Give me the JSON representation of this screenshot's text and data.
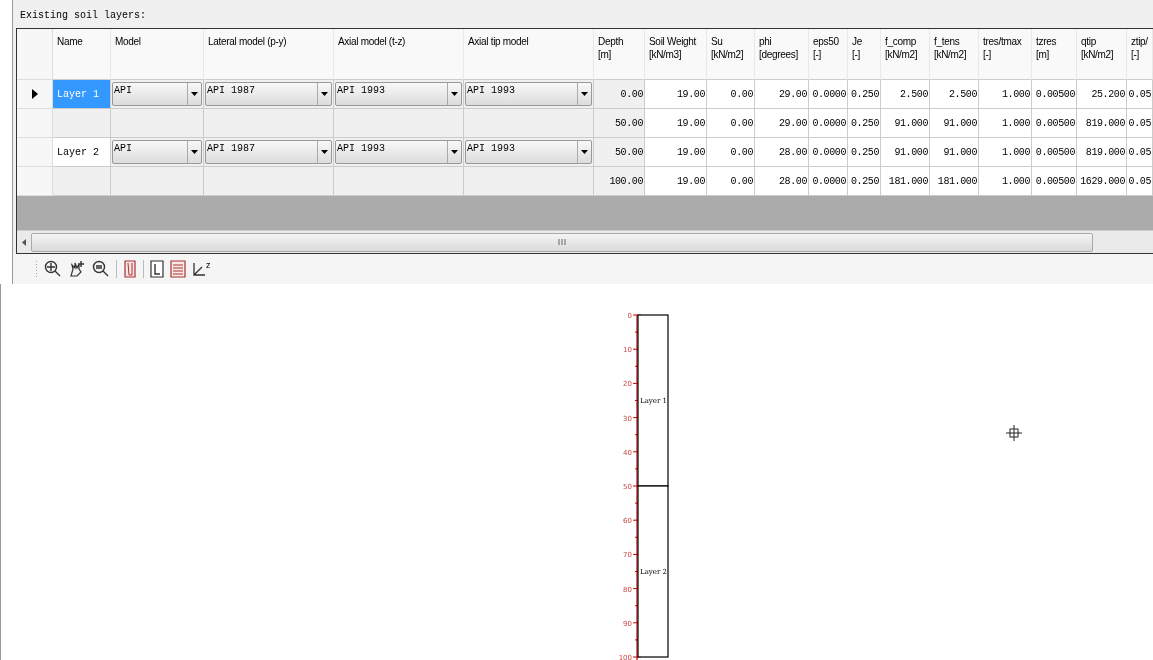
{
  "heading": "Existing soil layers:",
  "table": {
    "columns": [
      "Name",
      "Model",
      "Lateral model (p-y)",
      "Axial model (t-z)",
      "Axial tip model",
      "Depth\n[m]",
      "Soil Weight\n[kN/m3]",
      "Su\n[kN/m2]",
      "phi\n[degrees]",
      "eps50\n[-]",
      "Je\n[-]",
      "f_comp\n[kN/m2]",
      "f_tens\n[kN/m2]",
      "tres/tmax\n[-]",
      "tzres\n[m]",
      "qtip\n[kN/m2]",
      "ztip/\n[-]"
    ],
    "rows": [
      {
        "selected": true,
        "name": "Layer 1",
        "dropdowns": [
          "API",
          "API 1987",
          "API 1993",
          "API 1993"
        ],
        "values": [
          "0.00",
          "19.00",
          "0.00",
          "29.00",
          "0.0000",
          "0.250",
          "2.500",
          "2.500",
          "1.000",
          "0.00500",
          "25.200",
          "0.05"
        ]
      },
      {
        "selected": false,
        "values": [
          "50.00",
          "19.00",
          "0.00",
          "29.00",
          "0.0000",
          "0.250",
          "91.000",
          "91.000",
          "1.000",
          "0.00500",
          "819.000",
          "0.05"
        ]
      },
      {
        "selected": false,
        "name": "Layer 2",
        "dropdowns": [
          "API",
          "API 1987",
          "API 1993",
          "API 1993"
        ],
        "values": [
          "50.00",
          "19.00",
          "0.00",
          "28.00",
          "0.0000",
          "0.250",
          "91.000",
          "91.000",
          "1.000",
          "0.00500",
          "819.000",
          "0.05"
        ]
      },
      {
        "selected": false,
        "values": [
          "100.00",
          "19.00",
          "0.00",
          "28.00",
          "0.0000",
          "0.250",
          "181.000",
          "181.000",
          "1.000",
          "0.00500",
          "1629.000",
          "0.05"
        ]
      }
    ]
  },
  "toolbar": [
    {
      "kind": "zoom-in"
    },
    {
      "kind": "pan"
    },
    {
      "kind": "zoom-out"
    },
    {
      "kind": "sep"
    },
    {
      "kind": "pile"
    },
    {
      "kind": "sep"
    },
    {
      "kind": "document"
    },
    {
      "kind": "layers"
    },
    {
      "kind": "axes",
      "label": "z"
    }
  ],
  "profile": {
    "ticks": [
      "0",
      "10",
      "20",
      "30",
      "40",
      "50",
      "60",
      "70",
      "80",
      "90",
      "100"
    ],
    "layers": [
      {
        "label": "Layer 1"
      },
      {
        "label": "Layer 2"
      }
    ]
  }
}
